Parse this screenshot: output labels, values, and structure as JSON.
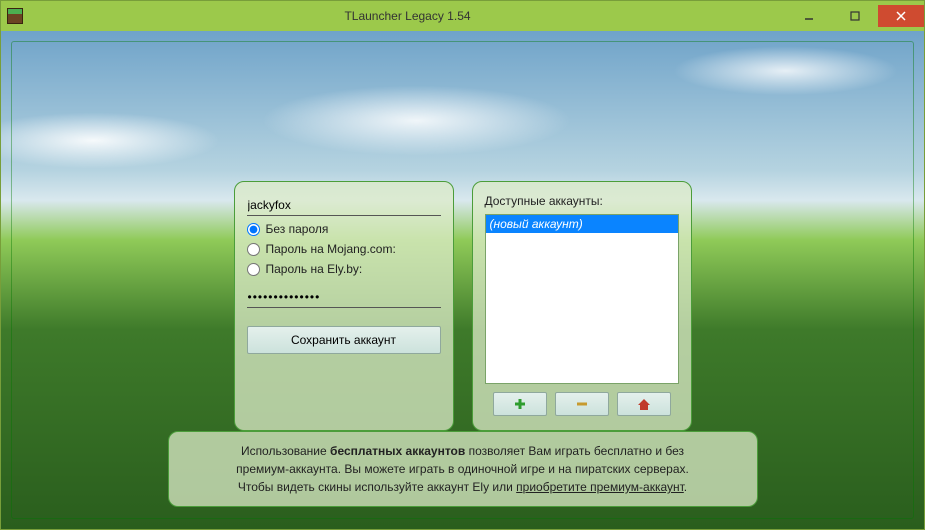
{
  "window": {
    "title": "TLauncher Legacy 1.54"
  },
  "login": {
    "username": "jackyfox",
    "radio_no_password": "Без пароля",
    "radio_mojang": "Пароль на Mojang.com:",
    "radio_ely": "Пароль на Ely.by:",
    "password_value": "••••••••••••••",
    "save_label": "Сохранить аккаунт",
    "selected_mode": "none"
  },
  "accounts": {
    "label": "Доступные аккаунты:",
    "items": [
      {
        "label": "(новый аккаунт)",
        "selected": true
      }
    ]
  },
  "info": {
    "line1_pre": "Использование ",
    "line1_bold": "бесплатных аккаунтов ",
    "line1_post": "позволяет Вам играть бесплатно и без",
    "line2": "премиум-аккаунта. Вы можете играть в одиночной игре и на пиратских серверах.",
    "line3_pre": "Чтобы видеть скины используйте аккаунт Ely или ",
    "line3_link": "приобретите премиум-аккаунт",
    "line3_post": "."
  }
}
